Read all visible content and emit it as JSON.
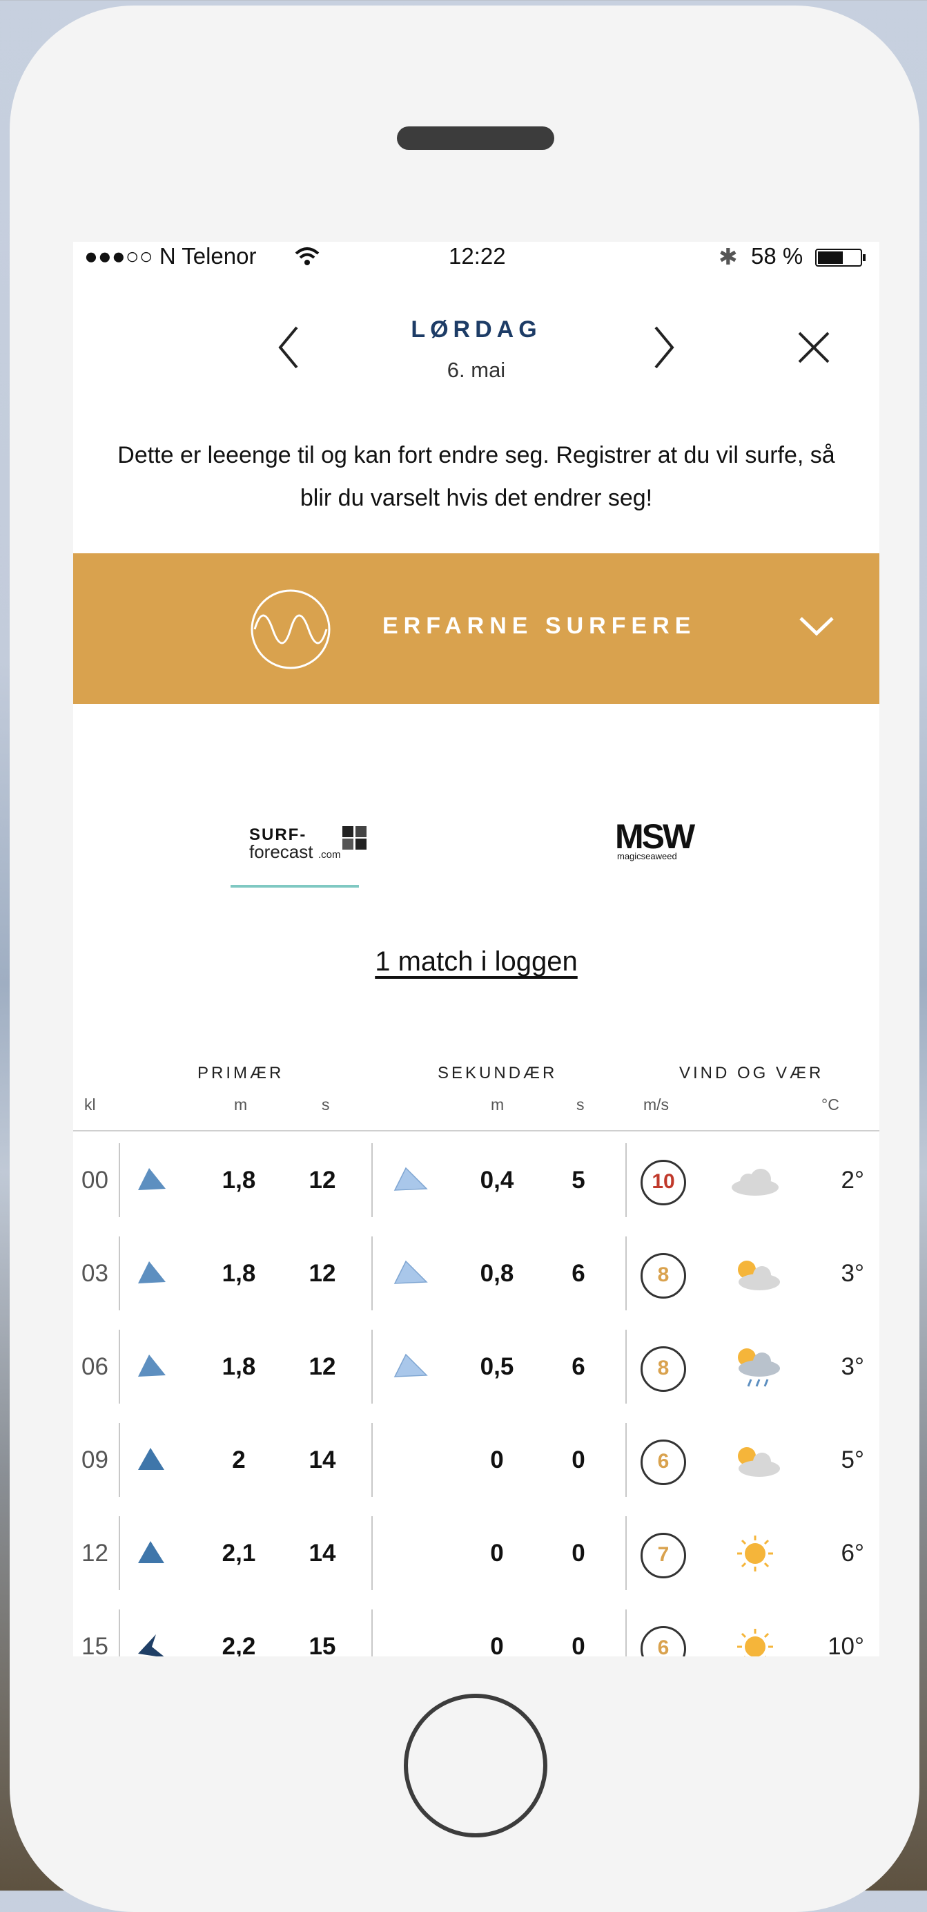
{
  "status_bar": {
    "carrier": "●●●○○ N Telenor",
    "time": "12:22",
    "battery": "58 %"
  },
  "nav": {
    "day": "LØRDAG",
    "date": "6. mai"
  },
  "notice": "Dette er leeenge til og kan fort endre seg. Registrer at du vil surfe, så blir du varselt hvis det endrer seg!",
  "level_banner": {
    "label": "ERFARNE SURFERE",
    "color": "#d9a24e"
  },
  "sources": {
    "active": "SURF-forecast.com",
    "other": "magicseaweed"
  },
  "match_link": "1 match i loggen",
  "table": {
    "group_headers": [
      "PRIMÆR",
      "SEKUNDÆR",
      "VIND OG VÆR"
    ],
    "sub_headers": {
      "kl": "kl",
      "p_m": "m",
      "p_s": "s",
      "s_m": "m",
      "s_s": "s",
      "wind": "m/s",
      "temp": "°C"
    },
    "rows": [
      {
        "kl": "00",
        "p_h": "1,8",
        "p_s": "12",
        "s_h": "0,4",
        "s_s": "5",
        "wind": "10",
        "wind_color": "#c0392b",
        "weather": "cloud-icon",
        "temp": "2°"
      },
      {
        "kl": "03",
        "p_h": "1,8",
        "p_s": "12",
        "s_h": "0,8",
        "s_s": "6",
        "wind": "8",
        "wind_color": "#d9a24e",
        "weather": "partly-sunny-icon",
        "temp": "3°"
      },
      {
        "kl": "06",
        "p_h": "1,8",
        "p_s": "12",
        "s_h": "0,5",
        "s_s": "6",
        "wind": "8",
        "wind_color": "#d9a24e",
        "weather": "sun-rain-icon",
        "temp": "3°"
      },
      {
        "kl": "09",
        "p_h": "2",
        "p_s": "14",
        "s_h": "0",
        "s_s": "0",
        "wind": "6",
        "wind_color": "#d9a24e",
        "weather": "partly-sunny-icon",
        "temp": "5°"
      },
      {
        "kl": "12",
        "p_h": "2,1",
        "p_s": "14",
        "s_h": "0",
        "s_s": "0",
        "wind": "7",
        "wind_color": "#d9a24e",
        "weather": "sun-icon",
        "temp": "6°"
      },
      {
        "kl": "15",
        "p_h": "2,2",
        "p_s": "15",
        "s_h": "0",
        "s_s": "0",
        "wind": "6",
        "wind_color": "#d9a24e",
        "weather": "sun-icon",
        "temp": "10°"
      }
    ]
  }
}
